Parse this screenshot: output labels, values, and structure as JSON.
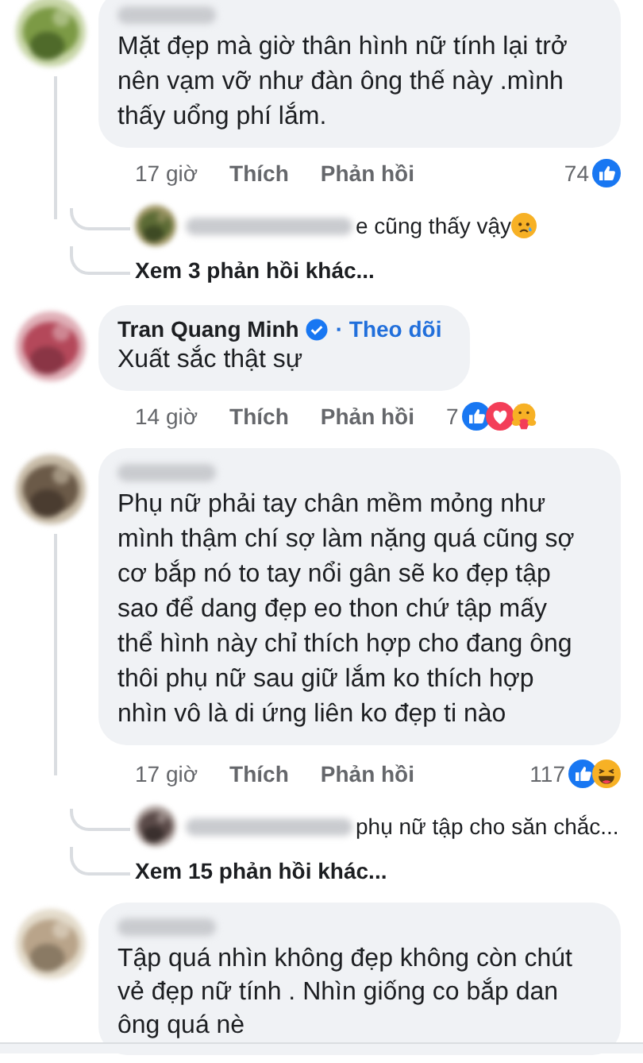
{
  "comments": [
    {
      "author_hidden": true,
      "text": "Mặt đẹp mà giờ thân hình nữ tính lại trở nên vạm vỡ như đàn ông thế này .mình thấy uổng phí lắm.",
      "time": "17 giờ",
      "like_label": "Thích",
      "reply_label": "Phản hồi",
      "reaction_count": "74",
      "reactions": [
        {
          "kind": "like"
        }
      ],
      "reply_preview": {
        "text": "e cũng thấy vậy",
        "emoji": {
          "kind": "sad"
        }
      },
      "more_replies": "Xem 3 phản hồi khác..."
    },
    {
      "author": "Tran Quang Minh",
      "verified": true,
      "follow_label": "· Theo dõi",
      "text": "Xuất sắc thật sự",
      "time": "14 giờ",
      "like_label": "Thích",
      "reply_label": "Phản hồi",
      "reaction_count": "7",
      "reactions": [
        {
          "kind": "like"
        },
        {
          "kind": "love"
        },
        {
          "kind": "care"
        }
      ]
    },
    {
      "author_hidden": true,
      "text": "Phụ nữ phải tay chân mềm mỏng như mình thậm chí sợ làm nặng quá cũng sợ cơ bắp nó to tay nổi gân sẽ ko đẹp tập sao để dang đẹp eo thon chứ tập mấy thể hình này chỉ thích hợp cho đang ông thôi phụ nữ sau giữ lắm ko thích hợp nhìn vô là di ứng liên ko đẹp ti nào",
      "time": "17 giờ",
      "like_label": "Thích",
      "reply_label": "Phản hồi",
      "reaction_count": "117",
      "reactions": [
        {
          "kind": "like"
        },
        {
          "kind": "haha"
        }
      ],
      "reply_preview": {
        "text": "phụ nữ tập cho săn chắc..."
      },
      "more_replies": "Xem 15 phản hồi khác..."
    },
    {
      "author_hidden": true,
      "text": "Tập quá nhìn không đẹp không còn chút vẻ đẹp nữ tính . Nhìn giống co bắp dan ông quá nè"
    }
  ]
}
